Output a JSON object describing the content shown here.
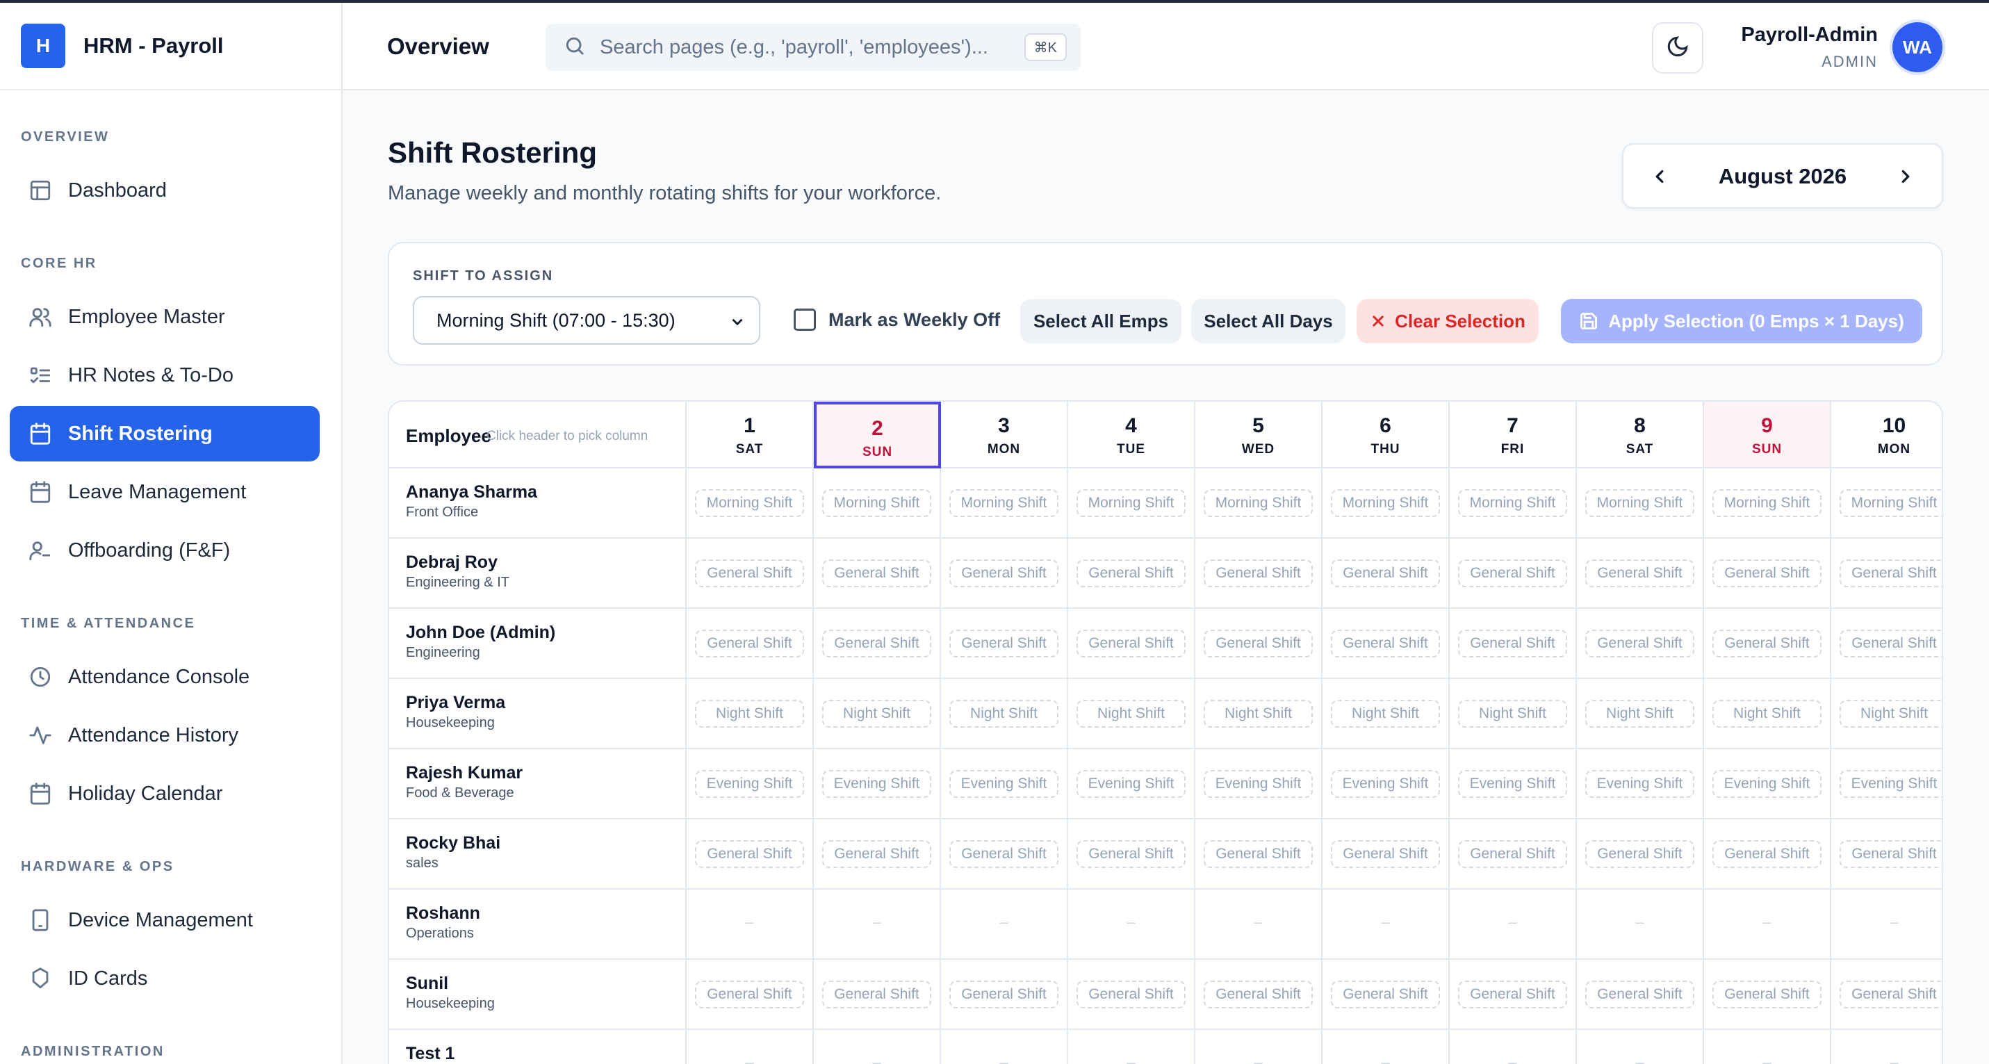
{
  "brand": {
    "logo_letter": "H",
    "name": "HRM - Payroll"
  },
  "sidebar": {
    "sections": [
      {
        "title": "OVERVIEW",
        "items": [
          {
            "label": "Dashboard",
            "icon": "layout-icon"
          }
        ]
      },
      {
        "title": "CORE HR",
        "items": [
          {
            "label": "Employee Master",
            "icon": "users-icon"
          },
          {
            "label": "HR Notes & To-Do",
            "icon": "list-todo-icon"
          },
          {
            "label": "Shift Rostering",
            "icon": "calendar-icon",
            "active": true
          },
          {
            "label": "Leave Management",
            "icon": "calendar-icon"
          },
          {
            "label": "Offboarding (F&F)",
            "icon": "user-minus-icon"
          }
        ]
      },
      {
        "title": "TIME & ATTENDANCE",
        "items": [
          {
            "label": "Attendance Console",
            "icon": "clock-icon"
          },
          {
            "label": "Attendance History",
            "icon": "activity-icon"
          },
          {
            "label": "Holiday Calendar",
            "icon": "calendar-icon"
          }
        ]
      },
      {
        "title": "HARDWARE & OPS",
        "items": [
          {
            "label": "Device Management",
            "icon": "tablet-icon"
          },
          {
            "label": "ID Cards",
            "icon": "badge-icon"
          }
        ]
      },
      {
        "title": "ADMINISTRATION",
        "items": []
      }
    ]
  },
  "header": {
    "title": "Overview",
    "search_placeholder": "Search pages (e.g., 'payroll', 'employees')...",
    "search_shortcut": "⌘K",
    "user_name": "Payroll-Admin",
    "user_role": "ADMIN",
    "avatar_initials": "WA"
  },
  "page": {
    "title": "Shift Rostering",
    "subtitle": "Manage weekly and monthly rotating shifts for your workforce.",
    "month": "August 2026"
  },
  "assign": {
    "label": "SHIFT TO ASSIGN",
    "selected_shift": "Morning Shift (07:00 - 15:30)",
    "weekly_off_label": "Mark as Weekly Off",
    "weekly_off_checked": false,
    "select_all_emps": "Select All Emps",
    "select_all_days": "Select All Days",
    "clear_selection": "Clear Selection",
    "apply_selection": "Apply Selection (0 Emps × 1 Days)"
  },
  "roster": {
    "employee_header": "Employee",
    "employee_hint": "Click header to pick column",
    "days": [
      {
        "num": "1",
        "dow": "SAT"
      },
      {
        "num": "2",
        "dow": "SUN",
        "sunday": true,
        "selected": true
      },
      {
        "num": "3",
        "dow": "MON"
      },
      {
        "num": "4",
        "dow": "TUE"
      },
      {
        "num": "5",
        "dow": "WED"
      },
      {
        "num": "6",
        "dow": "THU"
      },
      {
        "num": "7",
        "dow": "FRI"
      },
      {
        "num": "8",
        "dow": "SAT"
      },
      {
        "num": "9",
        "dow": "SUN",
        "sunday": true
      },
      {
        "num": "10",
        "dow": "MON"
      }
    ],
    "employees": [
      {
        "name": "Ananya Sharma",
        "dept": "Front Office",
        "shift": "Morning Shift"
      },
      {
        "name": "Debraj Roy",
        "dept": "Engineering & IT",
        "shift": "General Shift"
      },
      {
        "name": "John Doe (Admin)",
        "dept": "Engineering",
        "shift": "General Shift"
      },
      {
        "name": "Priya Verma",
        "dept": "Housekeeping",
        "shift": "Night Shift"
      },
      {
        "name": "Rajesh Kumar",
        "dept": "Food & Beverage",
        "shift": "Evening Shift"
      },
      {
        "name": "Rocky Bhai",
        "dept": "sales",
        "shift": "General Shift"
      },
      {
        "name": "Roshann",
        "dept": "Operations",
        "shift": ""
      },
      {
        "name": "Sunil",
        "dept": "Housekeeping",
        "shift": "General Shift"
      },
      {
        "name": "Test 1",
        "dept": "",
        "shift": ""
      }
    ],
    "empty_marker": "–"
  },
  "colors": {
    "accent": "#2563eb",
    "sunday": "#be123c",
    "danger": "#dc2626",
    "apply_disabled": "#a5b4fc"
  }
}
